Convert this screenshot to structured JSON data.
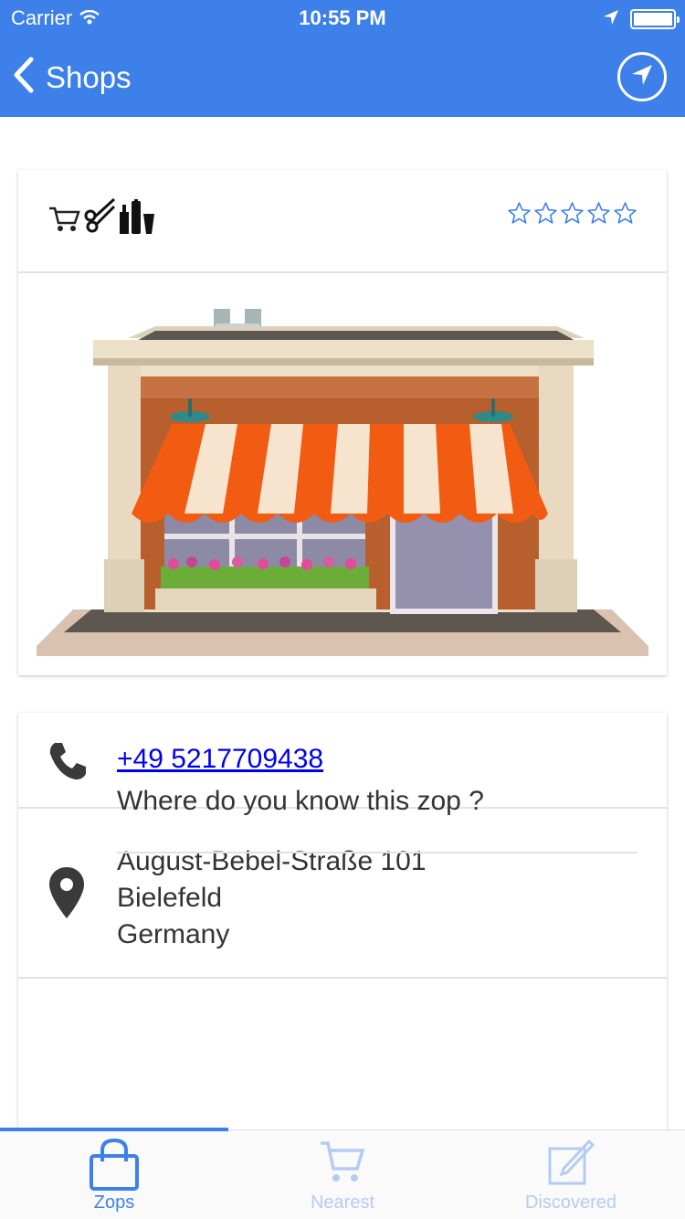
{
  "status_bar": {
    "carrier": "Carrier",
    "time": "10:55 PM"
  },
  "nav": {
    "back_label": "Shops"
  },
  "shop": {
    "category_icons": [
      "cart-icon",
      "scissors-icon",
      "bottles-icon"
    ],
    "rating": 0,
    "max_rating": 5,
    "image": "storefront-illustration",
    "phone": "+49 5217709438",
    "address": {
      "street": "August-Bebel-Straße 101",
      "city": "Bielefeld",
      "country": "Germany"
    },
    "question": "Where do you know this zop ?"
  },
  "tabs": [
    {
      "label": "Zops",
      "icon": "shopping-bag-icon",
      "active": true
    },
    {
      "label": "Nearest",
      "icon": "cart-icon",
      "active": false
    },
    {
      "label": "Discovered",
      "icon": "edit-icon",
      "active": false
    }
  ],
  "colors": {
    "primary": "#3d80ea",
    "tab_inactive": "#b4ccf3",
    "link": "#0000ee",
    "star_outline": "#3d80ea"
  }
}
